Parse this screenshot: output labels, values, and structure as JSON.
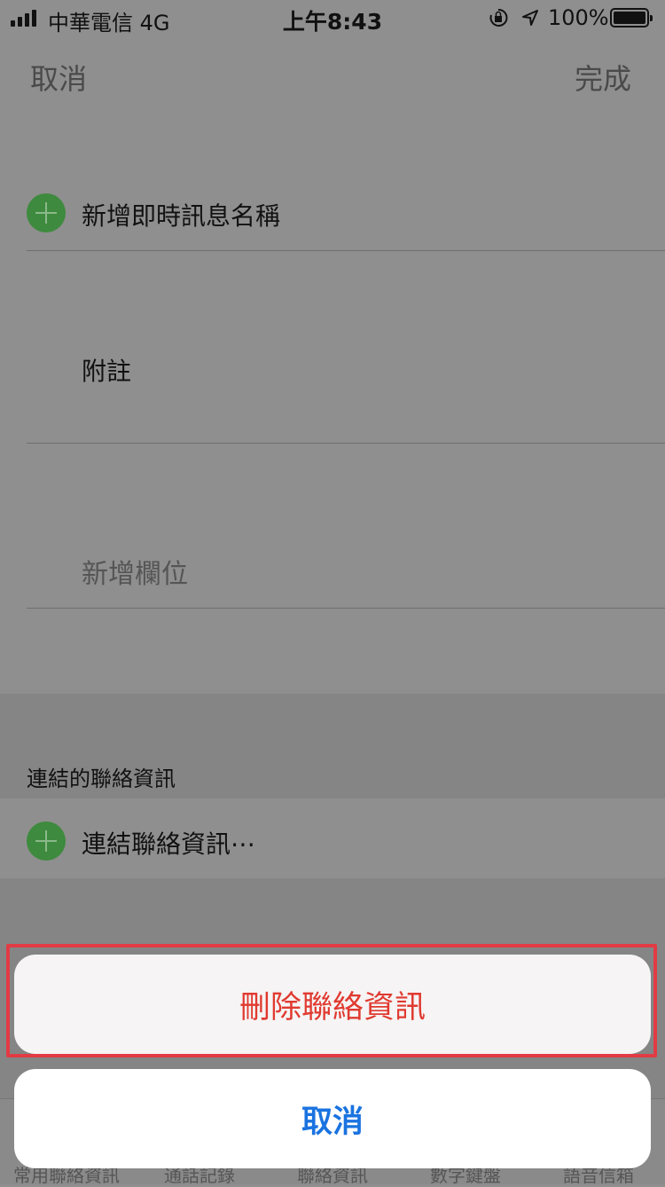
{
  "status_bar": {
    "carrier": "中華電信  4G",
    "time": "上午8:43",
    "battery": "100%",
    "icons": [
      "signal-icon",
      "orientation-lock-icon",
      "location-icon",
      "battery-icon"
    ]
  },
  "nav": {
    "cancel": "取消",
    "done": "完成"
  },
  "form": {
    "add_im": "新增即時訊息名稱",
    "notes": "附註",
    "add_field": "新增欄位"
  },
  "linked": {
    "header": "連結的聯絡資訊",
    "link_label": "連結聯絡資訊⋯"
  },
  "tabbar": {
    "items": [
      "常用聯絡資訊",
      "通話記錄",
      "聯絡資訊",
      "數字鍵盤",
      "語音信箱"
    ]
  },
  "action_sheet": {
    "delete": "刪除聯絡資訊",
    "cancel": "取消"
  },
  "colors": {
    "destructive": "#e03a30",
    "accent": "#1a73e0",
    "plus": "#3e8a3e",
    "highlight": "#e23b45"
  }
}
